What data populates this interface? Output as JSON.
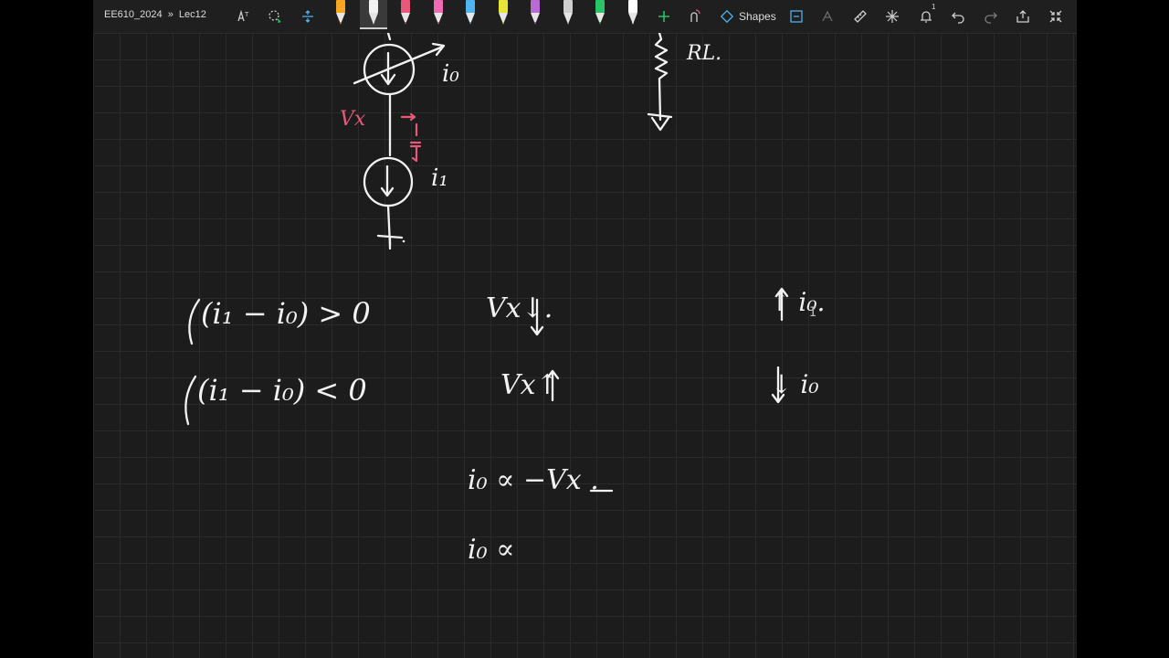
{
  "window": {
    "breadcrumb_notebook": "EE610_2024",
    "breadcrumb_separator": "»",
    "breadcrumb_page": "Lec12"
  },
  "toolbar": {
    "shapes_label": "Shapes",
    "notification_count": "1",
    "pen_colors": [
      "#f6a623",
      "#f2f2f2",
      "#e8587a",
      "#f06ab4",
      "#4fb3f0",
      "#e6e637",
      "#b86bd6",
      "#cfcfcf",
      "#29c464",
      "#ffffff"
    ],
    "selected_pen_index": 1,
    "add_pen_icon": "plus-icon"
  },
  "notes": {
    "rl_label": "RL.",
    "io_label": "i₀",
    "i1_label": "i₁",
    "vx_label": "Vx",
    "eq1_left": "(i₁ − i₀) > 0",
    "eq1_mid": "Vx↓.",
    "eq1_right": "↑ i₀.",
    "eq2_left": "(i₁ − i₀) < 0",
    "eq2_mid": "Vx↑",
    "eq2_right": "↓ i₀",
    "prop1": "i₀  ∝  −Vx .",
    "prop2": "i₀  ∝"
  }
}
